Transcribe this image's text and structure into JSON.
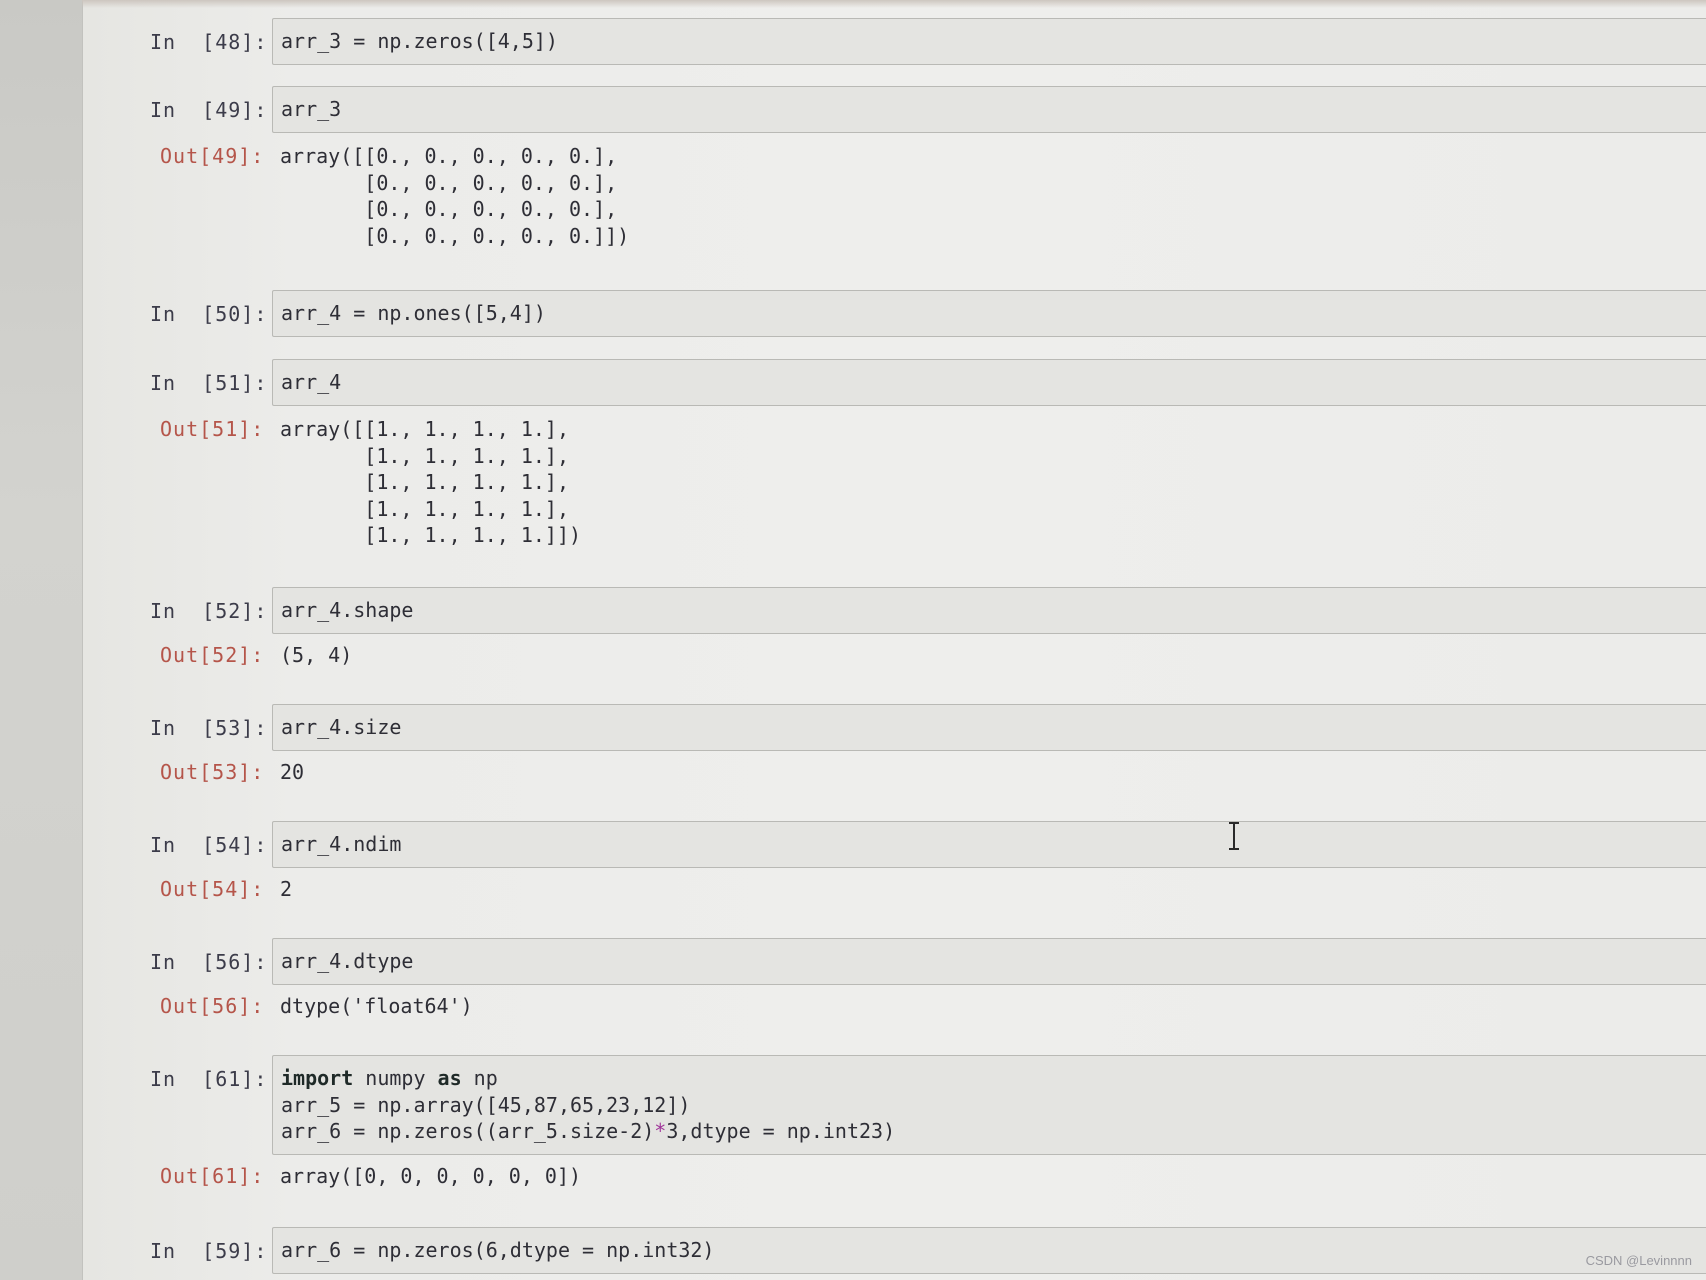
{
  "cells": [
    {
      "in_prompt": "In  [48]:",
      "code": [
        "arr_3 = np.zeros([4,5])"
      ],
      "out_prompt": null,
      "output": []
    },
    {
      "in_prompt": "In  [49]:",
      "code": [
        "arr_3"
      ],
      "out_prompt": "Out[49]:",
      "output": [
        "array([[0., 0., 0., 0., 0.],",
        "       [0., 0., 0., 0., 0.],",
        "       [0., 0., 0., 0., 0.],",
        "       [0., 0., 0., 0., 0.]])"
      ]
    },
    {
      "in_prompt": "In  [50]:",
      "code": [
        "arr_4 = np.ones([5,4])"
      ],
      "out_prompt": null,
      "output": []
    },
    {
      "in_prompt": "In  [51]:",
      "code": [
        "arr_4"
      ],
      "out_prompt": "Out[51]:",
      "output": [
        "array([[1., 1., 1., 1.],",
        "       [1., 1., 1., 1.],",
        "       [1., 1., 1., 1.],",
        "       [1., 1., 1., 1.],",
        "       [1., 1., 1., 1.]])"
      ]
    },
    {
      "in_prompt": "In  [52]:",
      "code": [
        "arr_4.shape"
      ],
      "out_prompt": "Out[52]:",
      "output": [
        "(5, 4)"
      ]
    },
    {
      "in_prompt": "In  [53]:",
      "code": [
        "arr_4.size"
      ],
      "out_prompt": "Out[53]:",
      "output": [
        "20"
      ]
    },
    {
      "in_prompt": "In  [54]:",
      "code": [
        "arr_4.ndim"
      ],
      "out_prompt": "Out[54]:",
      "output": [
        "2"
      ]
    },
    {
      "in_prompt": "In  [56]:",
      "code": [
        "arr_4.dtype"
      ],
      "out_prompt": "Out[56]:",
      "output": [
        "dtype('float64')"
      ]
    },
    {
      "in_prompt": "In  [61]:",
      "code_rich": [
        {
          "kw": "import",
          "rest": " numpy ",
          "kw2": "as",
          "rest2": " np"
        },
        {
          "plain": "arr_5 = np.array([45,87,65,23,12])"
        },
        {
          "pre": "arr_6 = np.zeros((arr_5.size-2)",
          "op": "*",
          "post": "3,dtype = np.int23)"
        }
      ],
      "out_prompt": "Out[61]:",
      "output": [
        "array([0, 0, 0, 0, 0, 0])"
      ]
    },
    {
      "in_prompt": "In  [59]:",
      "code": [
        "arr_6 = np.zeros(6,dtype = np.int32)"
      ],
      "out_prompt": null,
      "output": []
    }
  ],
  "watermark": "CSDN @Levinnnn",
  "icons": {
    "text_cursor": "i-beam-cursor-icon"
  }
}
